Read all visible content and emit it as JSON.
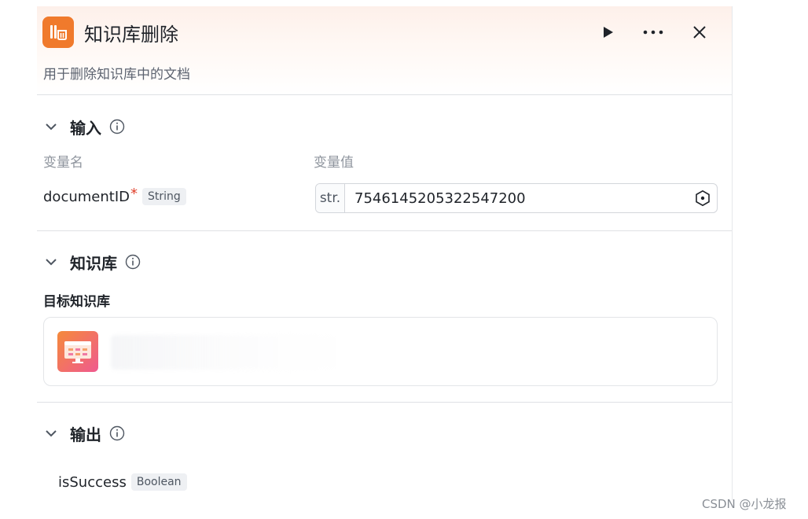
{
  "header": {
    "title": "知识库删除",
    "description": "用于删除知识库中的文档"
  },
  "input": {
    "section_title": "输入",
    "col_name": "变量名",
    "col_value": "变量值",
    "variable": {
      "name": "documentID",
      "required_mark": "*",
      "type": "String",
      "value_prefix": "str.",
      "value": "7546145205322547200"
    }
  },
  "knowledge": {
    "section_title": "知识库",
    "field_label": "目标知识库"
  },
  "output": {
    "section_title": "输出",
    "variable": {
      "name": "isSuccess",
      "type": "Boolean"
    }
  },
  "watermark": "CSDN @小龙报",
  "icons": [
    "knowledge-delete-icon",
    "run-icon",
    "more-icon",
    "close-icon",
    "chevron-down-icon",
    "info-icon",
    "variable-picker-icon",
    "knowledge-base-icon"
  ],
  "colors": {
    "accent": "#f07a2c",
    "required": "#e0402b"
  }
}
